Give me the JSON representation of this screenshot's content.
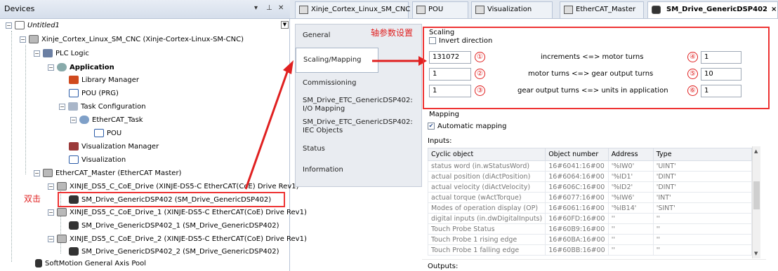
{
  "devices_panel": {
    "title": "Devices",
    "pin": "▾ ⊥ ✕",
    "tree": [
      {
        "label": "Untitled1",
        "italic": true
      },
      {
        "label": "Xinje_Cortex_Linux_SM_CNC (Xinje-Cortex-Linux-SM-CNC)"
      },
      {
        "label": "PLC Logic"
      },
      {
        "label": "Application",
        "bold": true
      },
      {
        "label": "Library Manager"
      },
      {
        "label": "POU (PRG)"
      },
      {
        "label": "Task Configuration"
      },
      {
        "label": "EtherCAT_Task"
      },
      {
        "label": "POU"
      },
      {
        "label": "Visualization Manager"
      },
      {
        "label": "Visualization"
      },
      {
        "label": "EtherCAT_Master (EtherCAT Master)"
      },
      {
        "label": "XINJE_DS5_C_CoE_Drive (XINJE-DS5-C EtherCAT(CoE) Drive Rev1)"
      },
      {
        "label": "SM_Drive_GenericDSP402 (SM_Drive_GenericDSP402)"
      },
      {
        "label": "XINJE_DS5_C_CoE_Drive_1 (XINJE-DS5-C EtherCAT(CoE) Drive Rev1)"
      },
      {
        "label": "SM_Drive_GenericDSP402_1 (SM_Drive_GenericDSP402)"
      },
      {
        "label": "XINJE_DS5_C_CoE_Drive_2 (XINJE-DS5-C EtherCAT(CoE) Drive Rev1)"
      },
      {
        "label": "SM_Drive_GenericDSP402_2 (SM_Drive_GenericDSP402)"
      },
      {
        "label": "SoftMotion General Axis Pool"
      }
    ],
    "annotation": "双击"
  },
  "tabs": [
    "Xinje_Cortex_Linux_SM_CNC",
    "POU",
    "Visualization",
    "EtherCAT_Master",
    "SM_Drive_GenericDSP402"
  ],
  "tab_close": "×",
  "sidebar": [
    "General",
    "Scaling/Mapping",
    "Commissioning",
    "SM_Drive_ETC_GenericDSP402: I/O Mapping",
    "SM_Drive_ETC_GenericDSP402: IEC Objects",
    "Status",
    "Information"
  ],
  "scaling": {
    "annotation": "轴参数设置",
    "title": "Scaling",
    "invert_direction": "Invert direction",
    "rows": [
      {
        "left": "131072",
        "num": "①",
        "label": "increments <=> motor turns",
        "rnum": "④",
        "right": "1"
      },
      {
        "left": "1",
        "num": "②",
        "label": "motor turns <=> gear output turns",
        "rnum": "⑤",
        "right": "10"
      },
      {
        "left": "1",
        "num": "③",
        "label": "gear output turns <=> units in application",
        "rnum": "⑥",
        "right": "1"
      }
    ]
  },
  "mapping": {
    "title": "Mapping",
    "automatic": "Automatic mapping",
    "inputs_label": "Inputs:",
    "outputs_label": "Outputs:",
    "columns": [
      "Cyclic object",
      "Object number",
      "Address",
      "Type"
    ],
    "rows": [
      [
        "status word (in.wStatusWord)",
        "16#6041:16#00",
        "'%IW0'",
        "'UINT'"
      ],
      [
        "actual position (diActPosition)",
        "16#6064:16#00",
        "'%ID1'",
        "'DINT'"
      ],
      [
        "actual velocity (diActVelocity)",
        "16#606C:16#00",
        "'%ID2'",
        "'DINT'"
      ],
      [
        "actual torque (wActTorque)",
        "16#6077:16#00",
        "'%IW6'",
        "'INT'"
      ],
      [
        "Modes of operation display (OP)",
        "16#6061:16#00",
        "'%IB14'",
        "'SINT'"
      ],
      [
        "digital inputs (in.dwDigitalInputs)",
        "16#60FD:16#00",
        "''",
        "''"
      ],
      [
        "Touch Probe Status",
        "16#60B9:16#00",
        "''",
        "''"
      ],
      [
        "Touch Probe 1 rising edge",
        "16#60BA:16#00",
        "''",
        "''"
      ],
      [
        "Touch Probe 1 falling edge",
        "16#60BB:16#00",
        "''",
        "''"
      ]
    ]
  },
  "colors": {
    "annotation_red": "#e02020",
    "panel_bg": "#e9ecf1"
  }
}
